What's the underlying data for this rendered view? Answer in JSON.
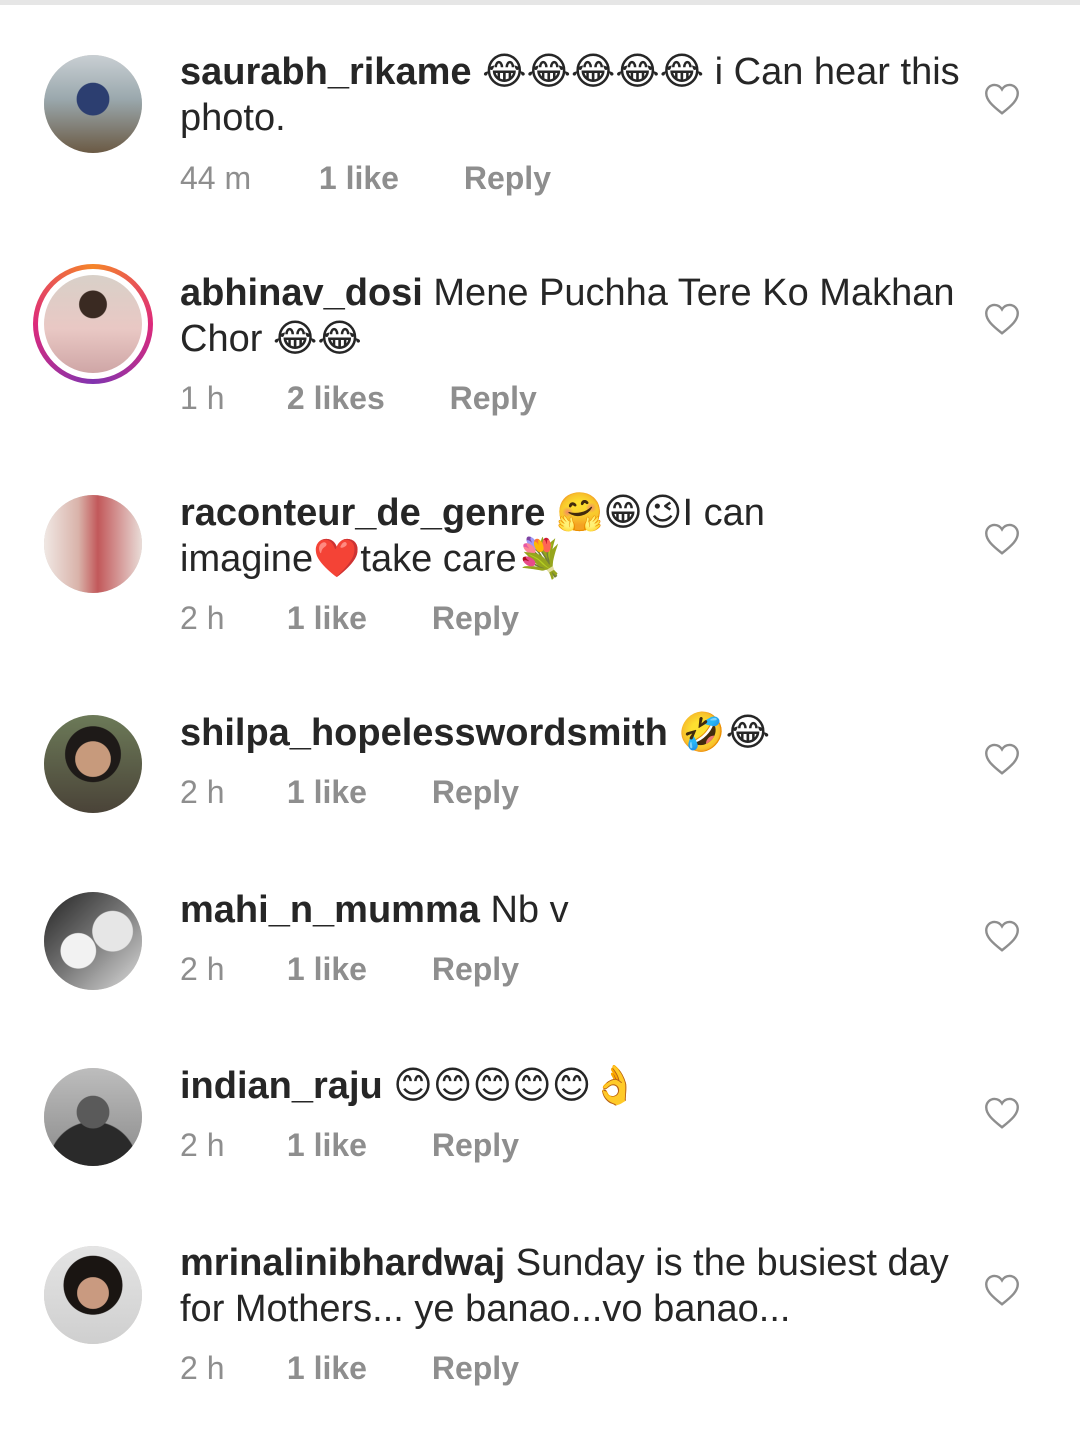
{
  "reply_label": "Reply",
  "comments": [
    {
      "username": "saurabh_rikame",
      "text": "😂😂😂😂😂 i Can hear this photo.",
      "time": "44 m",
      "likes": "1 like"
    },
    {
      "username": "abhinav_dosi",
      "text": "Mene Puchha Tere Ko Makhan Chor 😂😂",
      "time": "1 h",
      "likes": "2 likes"
    },
    {
      "username": "raconteur_de_genre",
      "text": "🤗😁😉I can imagine❤️take care💐",
      "time": "2 h",
      "likes": "1 like"
    },
    {
      "username": "shilpa_hopelesswordsmith",
      "text": "🤣😂",
      "time": "2 h",
      "likes": "1 like"
    },
    {
      "username": "mahi_n_mumma",
      "text": "Nb v",
      "time": "2 h",
      "likes": "1 like"
    },
    {
      "username": "indian_raju",
      "text": "😊😊😊😊😊👌",
      "time": "2 h",
      "likes": "1 like"
    },
    {
      "username": "mrinalinibhardwaj",
      "text": "Sunday is the busiest day for Mothers... ye banao...vo banao...",
      "time": "2 h",
      "likes": "1 like"
    }
  ],
  "colors": {
    "text": "#262626",
    "meta": "#8e8e8e",
    "story_ring": "#dd2a7b"
  },
  "icons": {
    "like": "heart-outline-icon"
  }
}
